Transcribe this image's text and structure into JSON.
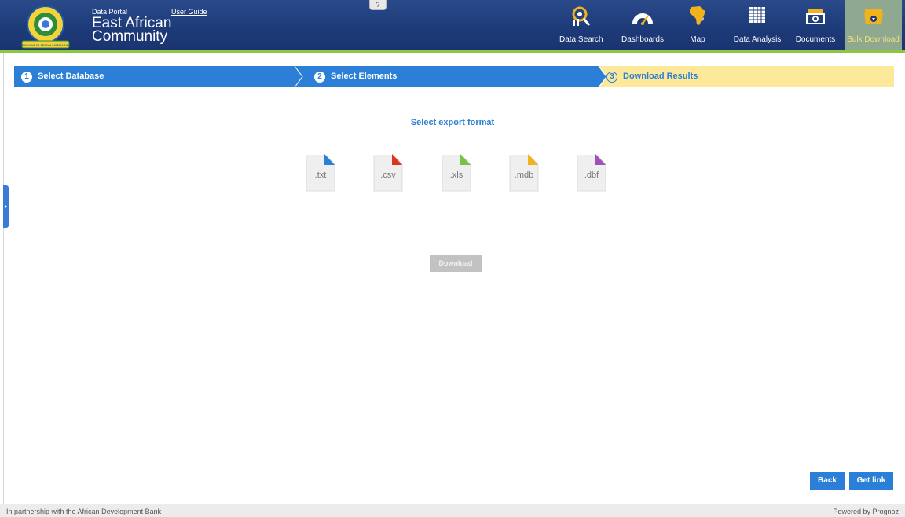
{
  "header": {
    "brand_small": "Data Portal",
    "brand_name": "East African Community",
    "user_guide": "User Guide",
    "help": "?",
    "logo_banner": "JUMUIYA YA AFRIKA MASHARIKI"
  },
  "nav": [
    {
      "label": "Data Search",
      "icon": "search-icon"
    },
    {
      "label": "Dashboards",
      "icon": "gauge-icon"
    },
    {
      "label": "Map",
      "icon": "africa-map-icon"
    },
    {
      "label": "Data Analysis",
      "icon": "grid-table-icon"
    },
    {
      "label": "Documents",
      "icon": "document-folder-icon"
    },
    {
      "label": "Bulk Download",
      "icon": "download-folder-icon",
      "active": true
    }
  ],
  "steps": [
    {
      "num": "1",
      "label": "Select Database"
    },
    {
      "num": "2",
      "label": "Select Elements"
    },
    {
      "num": "3",
      "label": "Download Results",
      "current": true
    }
  ],
  "main": {
    "title": "Select export format",
    "formats": [
      {
        "ext": ".txt",
        "color": "#2b7fd6"
      },
      {
        "ext": ".csv",
        "color": "#d9381e"
      },
      {
        "ext": ".xls",
        "color": "#7bc143"
      },
      {
        "ext": ".mdb",
        "color": "#f2b21b"
      },
      {
        "ext": ".dbf",
        "color": "#a051b5"
      }
    ],
    "download_label": "Download"
  },
  "actions": {
    "back": "Back",
    "get_link": "Get link"
  },
  "footer": {
    "left": "In partnership with the African Development Bank",
    "right": "Powered by Prognoz"
  },
  "colors": {
    "primary": "#2b7fd6",
    "header": "#1d3a78",
    "accent_strip": "#8dc63f",
    "current_step": "#fde99a"
  }
}
